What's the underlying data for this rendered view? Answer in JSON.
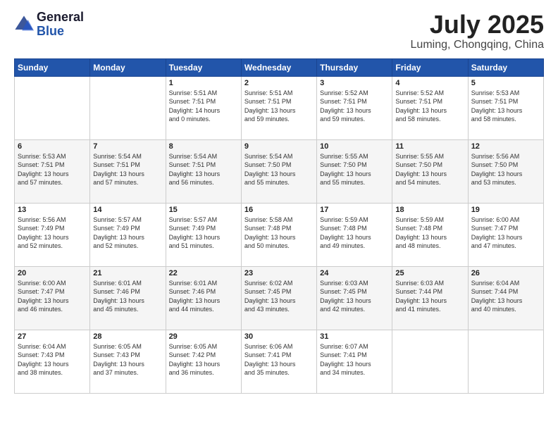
{
  "logo": {
    "general": "General",
    "blue": "Blue"
  },
  "header": {
    "month_title": "July 2025",
    "location": "Luming, Chongqing, China"
  },
  "days_of_week": [
    "Sunday",
    "Monday",
    "Tuesday",
    "Wednesday",
    "Thursday",
    "Friday",
    "Saturday"
  ],
  "weeks": [
    [
      {
        "day": "",
        "info": ""
      },
      {
        "day": "",
        "info": ""
      },
      {
        "day": "1",
        "info": "Sunrise: 5:51 AM\nSunset: 7:51 PM\nDaylight: 14 hours\nand 0 minutes."
      },
      {
        "day": "2",
        "info": "Sunrise: 5:51 AM\nSunset: 7:51 PM\nDaylight: 13 hours\nand 59 minutes."
      },
      {
        "day": "3",
        "info": "Sunrise: 5:52 AM\nSunset: 7:51 PM\nDaylight: 13 hours\nand 59 minutes."
      },
      {
        "day": "4",
        "info": "Sunrise: 5:52 AM\nSunset: 7:51 PM\nDaylight: 13 hours\nand 58 minutes."
      },
      {
        "day": "5",
        "info": "Sunrise: 5:53 AM\nSunset: 7:51 PM\nDaylight: 13 hours\nand 58 minutes."
      }
    ],
    [
      {
        "day": "6",
        "info": "Sunrise: 5:53 AM\nSunset: 7:51 PM\nDaylight: 13 hours\nand 57 minutes."
      },
      {
        "day": "7",
        "info": "Sunrise: 5:54 AM\nSunset: 7:51 PM\nDaylight: 13 hours\nand 57 minutes."
      },
      {
        "day": "8",
        "info": "Sunrise: 5:54 AM\nSunset: 7:51 PM\nDaylight: 13 hours\nand 56 minutes."
      },
      {
        "day": "9",
        "info": "Sunrise: 5:54 AM\nSunset: 7:50 PM\nDaylight: 13 hours\nand 55 minutes."
      },
      {
        "day": "10",
        "info": "Sunrise: 5:55 AM\nSunset: 7:50 PM\nDaylight: 13 hours\nand 55 minutes."
      },
      {
        "day": "11",
        "info": "Sunrise: 5:55 AM\nSunset: 7:50 PM\nDaylight: 13 hours\nand 54 minutes."
      },
      {
        "day": "12",
        "info": "Sunrise: 5:56 AM\nSunset: 7:50 PM\nDaylight: 13 hours\nand 53 minutes."
      }
    ],
    [
      {
        "day": "13",
        "info": "Sunrise: 5:56 AM\nSunset: 7:49 PM\nDaylight: 13 hours\nand 52 minutes."
      },
      {
        "day": "14",
        "info": "Sunrise: 5:57 AM\nSunset: 7:49 PM\nDaylight: 13 hours\nand 52 minutes."
      },
      {
        "day": "15",
        "info": "Sunrise: 5:57 AM\nSunset: 7:49 PM\nDaylight: 13 hours\nand 51 minutes."
      },
      {
        "day": "16",
        "info": "Sunrise: 5:58 AM\nSunset: 7:48 PM\nDaylight: 13 hours\nand 50 minutes."
      },
      {
        "day": "17",
        "info": "Sunrise: 5:59 AM\nSunset: 7:48 PM\nDaylight: 13 hours\nand 49 minutes."
      },
      {
        "day": "18",
        "info": "Sunrise: 5:59 AM\nSunset: 7:48 PM\nDaylight: 13 hours\nand 48 minutes."
      },
      {
        "day": "19",
        "info": "Sunrise: 6:00 AM\nSunset: 7:47 PM\nDaylight: 13 hours\nand 47 minutes."
      }
    ],
    [
      {
        "day": "20",
        "info": "Sunrise: 6:00 AM\nSunset: 7:47 PM\nDaylight: 13 hours\nand 46 minutes."
      },
      {
        "day": "21",
        "info": "Sunrise: 6:01 AM\nSunset: 7:46 PM\nDaylight: 13 hours\nand 45 minutes."
      },
      {
        "day": "22",
        "info": "Sunrise: 6:01 AM\nSunset: 7:46 PM\nDaylight: 13 hours\nand 44 minutes."
      },
      {
        "day": "23",
        "info": "Sunrise: 6:02 AM\nSunset: 7:45 PM\nDaylight: 13 hours\nand 43 minutes."
      },
      {
        "day": "24",
        "info": "Sunrise: 6:03 AM\nSunset: 7:45 PM\nDaylight: 13 hours\nand 42 minutes."
      },
      {
        "day": "25",
        "info": "Sunrise: 6:03 AM\nSunset: 7:44 PM\nDaylight: 13 hours\nand 41 minutes."
      },
      {
        "day": "26",
        "info": "Sunrise: 6:04 AM\nSunset: 7:44 PM\nDaylight: 13 hours\nand 40 minutes."
      }
    ],
    [
      {
        "day": "27",
        "info": "Sunrise: 6:04 AM\nSunset: 7:43 PM\nDaylight: 13 hours\nand 38 minutes."
      },
      {
        "day": "28",
        "info": "Sunrise: 6:05 AM\nSunset: 7:43 PM\nDaylight: 13 hours\nand 37 minutes."
      },
      {
        "day": "29",
        "info": "Sunrise: 6:05 AM\nSunset: 7:42 PM\nDaylight: 13 hours\nand 36 minutes."
      },
      {
        "day": "30",
        "info": "Sunrise: 6:06 AM\nSunset: 7:41 PM\nDaylight: 13 hours\nand 35 minutes."
      },
      {
        "day": "31",
        "info": "Sunrise: 6:07 AM\nSunset: 7:41 PM\nDaylight: 13 hours\nand 34 minutes."
      },
      {
        "day": "",
        "info": ""
      },
      {
        "day": "",
        "info": ""
      }
    ]
  ]
}
